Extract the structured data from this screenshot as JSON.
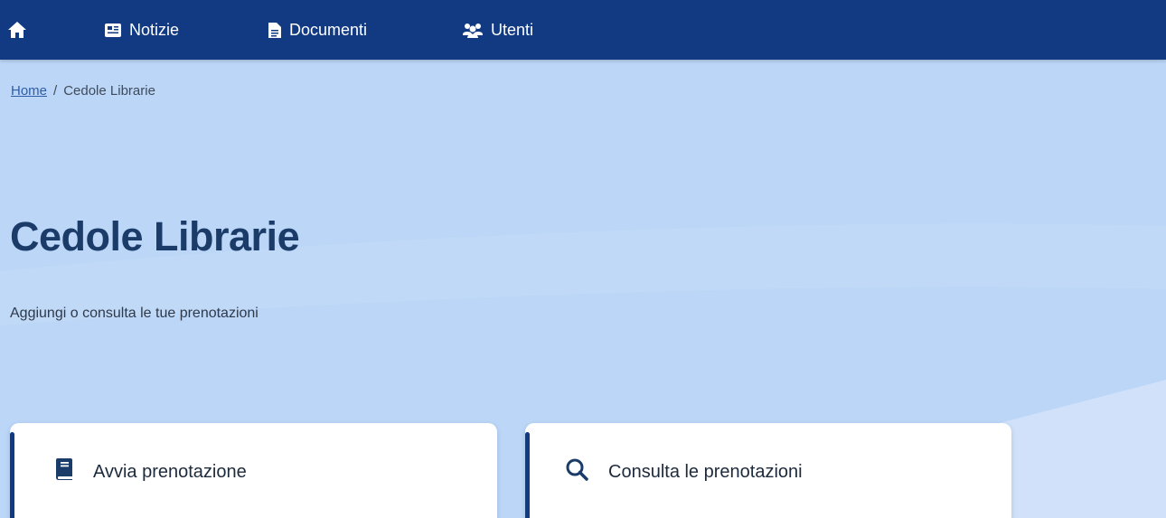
{
  "nav": {
    "home_icon": "home-icon",
    "items": [
      {
        "label": "Notizie",
        "icon": "newspaper-icon"
      },
      {
        "label": "Documenti",
        "icon": "document-icon"
      },
      {
        "label": "Utenti",
        "icon": "users-icon"
      }
    ]
  },
  "breadcrumb": {
    "home": "Home",
    "separator": "/",
    "current": "Cedole Librarie"
  },
  "page": {
    "title": "Cedole Librarie",
    "subtitle": "Aggiungi o consulta le tue prenotazioni"
  },
  "cards": [
    {
      "label": "Avvia prenotazione",
      "icon": "book-icon"
    },
    {
      "label": "Consulta le prenotazioni",
      "icon": "search-icon"
    }
  ],
  "colors": {
    "header": "#123a82",
    "background": "#bcd6f7",
    "title": "#1b3c69",
    "link": "#2f5da8",
    "card": "#ffffff"
  }
}
